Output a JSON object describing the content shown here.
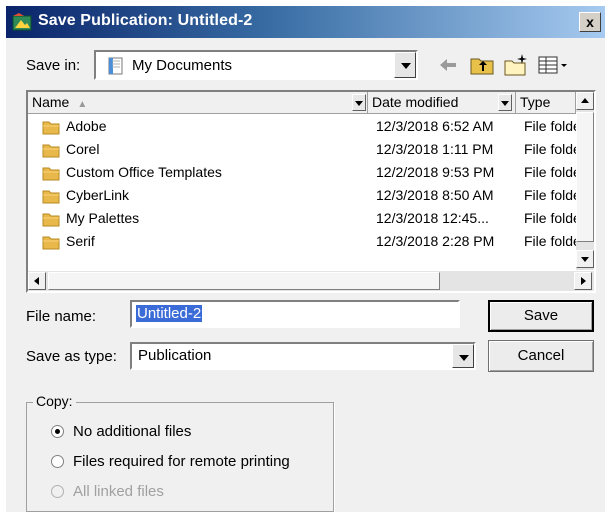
{
  "window": {
    "title": "Save Publication: Untitled-2",
    "close": "x"
  },
  "save_in": {
    "label": "Save in:",
    "value": "My Documents"
  },
  "list": {
    "headers": {
      "name": "Name",
      "date": "Date modified",
      "type": "Type"
    },
    "rows": [
      {
        "name": "Adobe",
        "date": "12/3/2018 6:52 AM",
        "type": "File folde"
      },
      {
        "name": "Corel",
        "date": "12/3/2018 1:11 PM",
        "type": "File folde"
      },
      {
        "name": "Custom Office Templates",
        "date": "12/2/2018 9:53 PM",
        "type": "File folde"
      },
      {
        "name": "CyberLink",
        "date": "12/3/2018 8:50 AM",
        "type": "File folde"
      },
      {
        "name": "My Palettes",
        "date": "12/3/2018 12:45...",
        "type": "File folde"
      },
      {
        "name": "Serif",
        "date": "12/3/2018 2:28 PM",
        "type": "File folde"
      }
    ]
  },
  "file_name": {
    "label": "File name:",
    "value": "Untitled-2"
  },
  "save_as_type": {
    "label": "Save as type:",
    "value": "Publication"
  },
  "buttons": {
    "save": "Save",
    "cancel": "Cancel"
  },
  "copy_group": {
    "legend": "Copy:",
    "options": [
      {
        "label": "No additional files",
        "checked": true,
        "enabled": true
      },
      {
        "label": "Files required for remote printing",
        "checked": false,
        "enabled": true
      },
      {
        "label": "All linked files",
        "checked": false,
        "enabled": false
      }
    ]
  },
  "colors": {
    "title_bar": "#0a246a",
    "selection": "#3b6bd6",
    "folder": "#e8b84a",
    "dialog_bg": "#f0f0f0"
  },
  "icons": [
    "publication-icon",
    "folder-icon",
    "back-arrow-icon",
    "up-folder-icon",
    "new-folder-icon",
    "view-menu-icon"
  ]
}
